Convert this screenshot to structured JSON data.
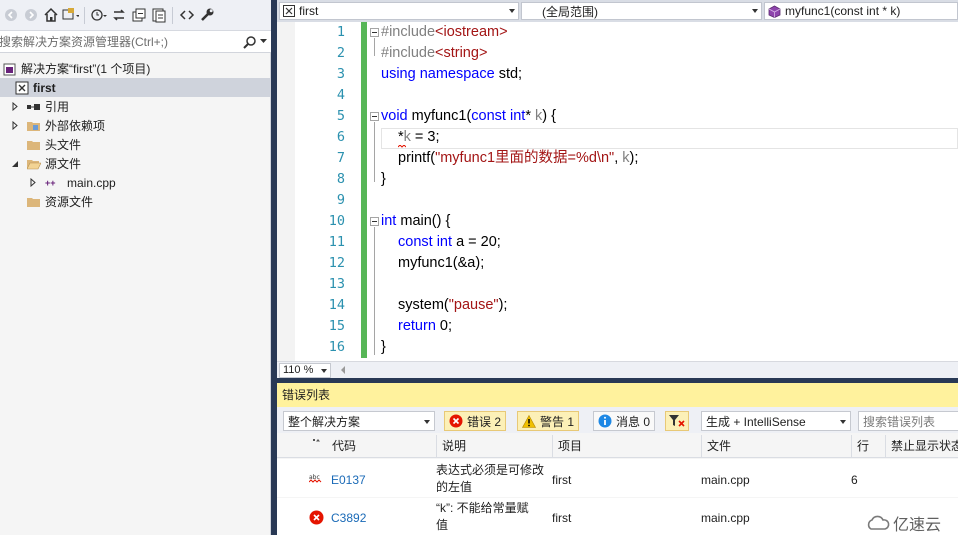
{
  "solution_explorer": {
    "search_placeholder": "搜索解决方案资源管理器(Ctrl+;)",
    "solution_label": "解决方案“first”(1 个项目)",
    "project": "first",
    "items": {
      "references": "引用",
      "external_deps": "外部依赖项",
      "header_files": "头文件",
      "source_files": "源文件",
      "main_cpp": "main.cpp",
      "resource_files": "资源文件"
    }
  },
  "editor": {
    "nav": {
      "project": "first",
      "scope": "(全局范围)",
      "member": "myfunc1(const int * k)"
    },
    "line_numbers": [
      "1",
      "2",
      "3",
      "4",
      "5",
      "6",
      "7",
      "8",
      "9",
      "10",
      "11",
      "12",
      "13",
      "14",
      "15",
      "16"
    ],
    "code": {
      "l1a": "#include",
      "l1b": "<iostream>",
      "l2a": "#include",
      "l2b": "<string>",
      "l3a": "using",
      "l3b": "namespace",
      "l3c": "std;",
      "l5a": "void",
      "l5b": "myfunc1(",
      "l5c": "const",
      "l5d": "int",
      "l5e": "*",
      "l5f": "k",
      "l5g": ") {",
      "l6a": "*",
      "l6b": "k",
      "l6c": " = 3;",
      "l7a": "printf(",
      "l7b": "\"myfunc1里面的数据=%d\\n\"",
      "l7c": ", ",
      "l7d": "k",
      "l7e": ");",
      "l8": "}",
      "l10a": "int",
      "l10b": "main() {",
      "l11a": "const",
      "l11b": "int",
      "l11c": "a = 20;",
      "l12": "myfunc1(&a);",
      "l14a": "system(",
      "l14b": "\"pause\"",
      "l14c": ");",
      "l15a": "return",
      "l15b": "0;",
      "l16": "}"
    },
    "zoom": "110 %"
  },
  "error_list": {
    "title": "错误列表",
    "scope": "整个解决方案",
    "errors_btn": "错误 2",
    "warnings_btn": "警告 1",
    "messages_btn": "消息 0",
    "build_filter": "生成 + IntelliSense",
    "search_placeholder": "搜索错误列表",
    "columns": {
      "code": "代码",
      "desc": "说明",
      "project": "项目",
      "file": "文件",
      "line": "行",
      "suppress": "禁止显示状态"
    },
    "rows": [
      {
        "code": "E0137",
        "desc1": "表达式必须是可修改",
        "desc2": "的左值",
        "project": "first",
        "file": "main.cpp",
        "line": "6"
      },
      {
        "code": "C3892",
        "desc1": "“k”: 不能给常量赋",
        "desc2": "值",
        "project": "first",
        "file": "main.cpp",
        "line": ""
      }
    ]
  },
  "watermark": "亿速云",
  "colors": {
    "keyword": "#0000ff",
    "string": "#a31515",
    "line_number": "#2b91af",
    "changed_bar": "#57b657",
    "error_title_bg": "#fff29d",
    "error_red": "#e51400",
    "code_link": "#1a6ab7"
  }
}
